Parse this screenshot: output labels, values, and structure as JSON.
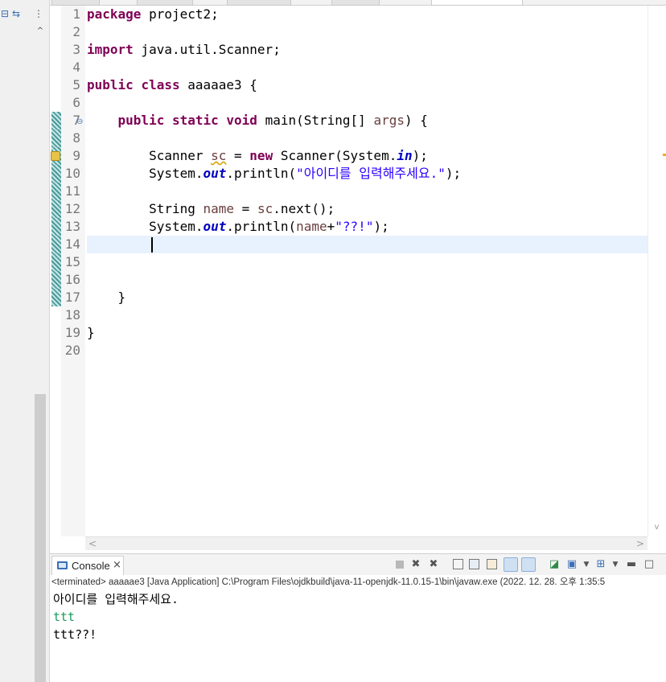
{
  "left_panel": {
    "icons": [
      "collapse-all-icon",
      "link-with-editor-icon",
      "view-menu-icon"
    ]
  },
  "editor": {
    "line_numbers": [
      "1",
      "2",
      "3",
      "4",
      "5",
      "6",
      "7",
      "8",
      "9",
      "10",
      "11",
      "12",
      "13",
      "14",
      "15",
      "16",
      "17",
      "18",
      "19",
      "20"
    ],
    "fold_marker": "⊖",
    "lines": [
      [
        {
          "t": "package",
          "c": "kw"
        },
        {
          "t": " project2;"
        }
      ],
      [],
      [
        {
          "t": "import",
          "c": "kw"
        },
        {
          "t": " java.util.Scanner;"
        }
      ],
      [],
      [
        {
          "t": "public",
          "c": "kw"
        },
        {
          "t": " "
        },
        {
          "t": "class",
          "c": "kw"
        },
        {
          "t": " aaaaae3 {"
        }
      ],
      [],
      [
        {
          "t": "    "
        },
        {
          "t": "public",
          "c": "kw"
        },
        {
          "t": " "
        },
        {
          "t": "static",
          "c": "kw"
        },
        {
          "t": " "
        },
        {
          "t": "void",
          "c": "kw"
        },
        {
          "t": " main(String[] "
        },
        {
          "t": "args",
          "c": "var"
        },
        {
          "t": ") {"
        }
      ],
      [],
      [
        {
          "t": "        Scanner "
        },
        {
          "t": "sc",
          "c": "var warn-ul"
        },
        {
          "t": " = "
        },
        {
          "t": "new",
          "c": "kw"
        },
        {
          "t": " Scanner(System."
        },
        {
          "t": "in",
          "c": "fld"
        },
        {
          "t": ");"
        }
      ],
      [
        {
          "t": "        System."
        },
        {
          "t": "out",
          "c": "fld"
        },
        {
          "t": ".println("
        },
        {
          "t": "\"아이디를 입력해주세요.\"",
          "c": "str"
        },
        {
          "t": ");"
        }
      ],
      [],
      [
        {
          "t": "        String "
        },
        {
          "t": "name",
          "c": "var"
        },
        {
          "t": " = "
        },
        {
          "t": "sc",
          "c": "var"
        },
        {
          "t": ".next();"
        }
      ],
      [
        {
          "t": "        System."
        },
        {
          "t": "out",
          "c": "fld"
        },
        {
          "t": ".println("
        },
        {
          "t": "name",
          "c": "var"
        },
        {
          "t": "+"
        },
        {
          "t": "\"??!\"",
          "c": "str"
        },
        {
          "t": ");"
        }
      ],
      [],
      [],
      [],
      [
        {
          "t": "    }"
        }
      ],
      [],
      [
        {
          "t": "}"
        }
      ],
      []
    ],
    "changed_lines": [
      7,
      8,
      9,
      10,
      11,
      12,
      13,
      14,
      15,
      16,
      17
    ],
    "warning_line": 9,
    "current_line": 14,
    "colors": {
      "keyword": "#7f0055",
      "string": "#2a00ff",
      "local_variable": "#6a3e3e",
      "static_field": "#0000c0",
      "current_line_highlight": "#e8f2fe"
    }
  },
  "console": {
    "tab_label": "Console",
    "close_glyph": "×",
    "status": "<terminated> aaaaae3 [Java Application] C:\\Program Files\\ojdkbuild\\java-11-openjdk-11.0.15-1\\bin\\javaw.exe  (2022. 12. 28. 오후 1:35:5",
    "output": [
      {
        "text": "아이디를 입력해주세요.",
        "color": "#000000"
      },
      {
        "text": "ttt",
        "color": "#1a9a5c"
      },
      {
        "text": "ttt??!",
        "color": "#000000"
      }
    ],
    "toolbar_icons": [
      "terminate-icon",
      "remove-launch-icon",
      "remove-all-terminated-icon",
      "clear-console-icon",
      "scroll-lock-icon",
      "word-wrap-icon",
      "show-on-stdout-icon",
      "show-on-stderr-icon",
      "pin-console-icon",
      "display-selected-console-icon",
      "open-console-icon",
      "view-menu-icon",
      "minimize-icon",
      "maximize-icon"
    ]
  }
}
